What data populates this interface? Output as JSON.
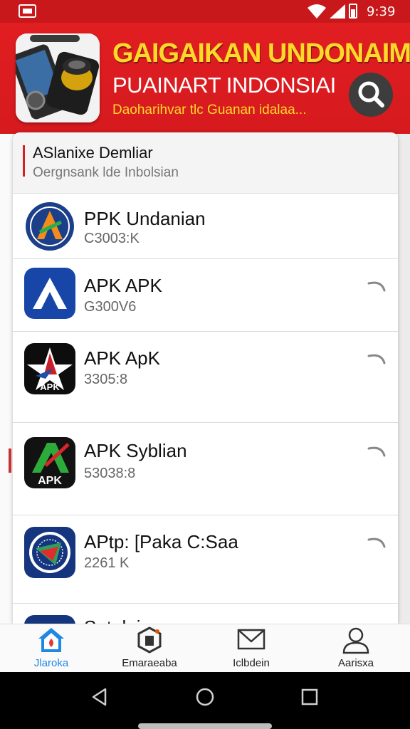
{
  "status_bar": {
    "time": "9:39",
    "left_icon": "gallery-icon",
    "icons": [
      "wifi-icon",
      "signal-icon",
      "battery-icon"
    ]
  },
  "header": {
    "title_line1": "GAIGAIKAN UNDONAIM",
    "title_line2": "PUAINART INDONSIAI",
    "title_line3": "Daoharihvar tlc Guanan idalaa...",
    "search_icon": "search-icon",
    "logo_icon": "phone-speaker-logo-icon"
  },
  "section": {
    "title": "ASlanixe Demliar",
    "subtitle": "Oergnsank lde Inbolsian"
  },
  "apps": [
    {
      "name": "PPK Undanian",
      "size": "C3003:K",
      "icon": "globe-a-app-icon"
    },
    {
      "name": "APK APK",
      "size": "G300V6",
      "icon": "blue-a-app-icon"
    },
    {
      "name": "APK ApK",
      "size": "3305:8",
      "icon": "star-apk-app-icon",
      "badge": "APK"
    },
    {
      "name": "APK Syblian",
      "size": "53038:8",
      "icon": "green-apk-app-icon",
      "badge": "APK"
    },
    {
      "name": "APtp: [Paka C:Saa",
      "size": "2261 K",
      "icon": "emblem-app-icon"
    },
    {
      "name": "Sotuluiu",
      "size": "",
      "icon": "partial-app-icon"
    }
  ],
  "bottom_nav": [
    {
      "label": "Jlaroka",
      "icon": "home-icon",
      "active": true
    },
    {
      "label": "Emaraeaba",
      "icon": "package-icon",
      "active": false
    },
    {
      "label": "Iclbdein",
      "icon": "mail-icon",
      "active": false
    },
    {
      "label": "Aarisxa",
      "icon": "profile-icon",
      "active": false
    }
  ],
  "system_nav": [
    "back-icon",
    "home-circle-icon",
    "recents-icon"
  ],
  "colors": {
    "brand_red": "#d51a1e",
    "accent_yellow": "#ffd92a",
    "active_blue": "#1e88e5"
  }
}
